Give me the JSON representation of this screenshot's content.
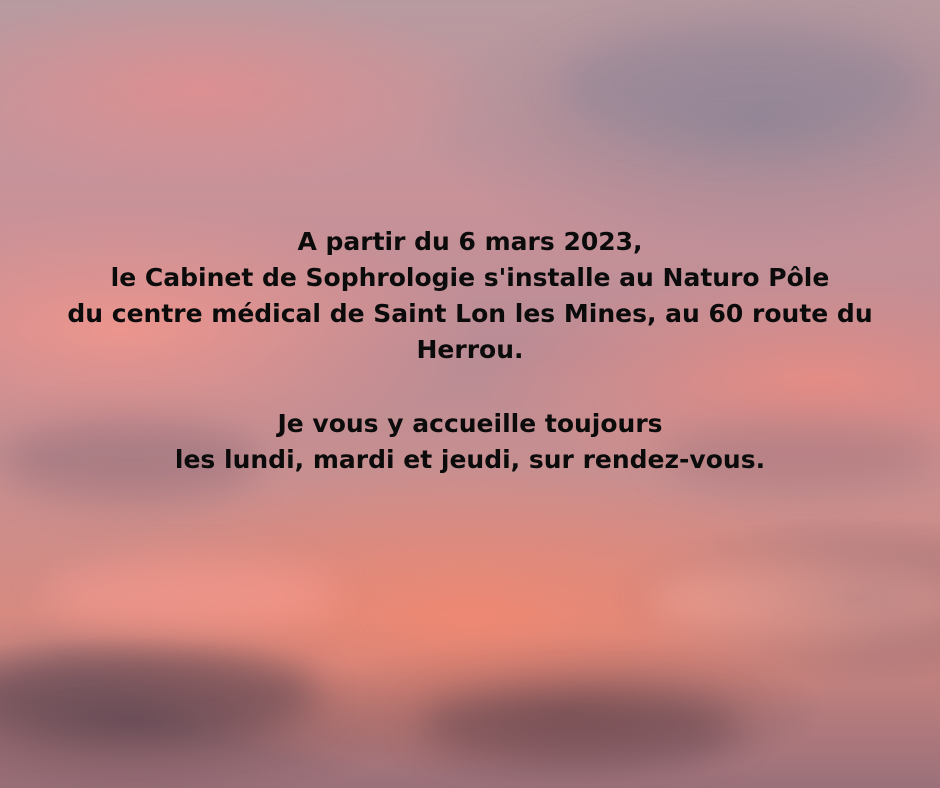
{
  "announcement": {
    "lines": [
      "A partir du 6 mars 2023,",
      "le Cabinet de Sophrologie s'installe au Naturo Pôle",
      "du centre médical de Saint Lon les Mines, au 60 route du",
      "Herrou."
    ],
    "schedule_lines": [
      "Je vous y accueille toujours",
      "les lundi, mardi et jeudi, sur rendez-vous."
    ]
  },
  "colors": {
    "text": "#0b0b0b",
    "sky_pink": "#d68a80",
    "sky_grey": "#b79aa0",
    "cloud_dark": "#6e505a"
  }
}
